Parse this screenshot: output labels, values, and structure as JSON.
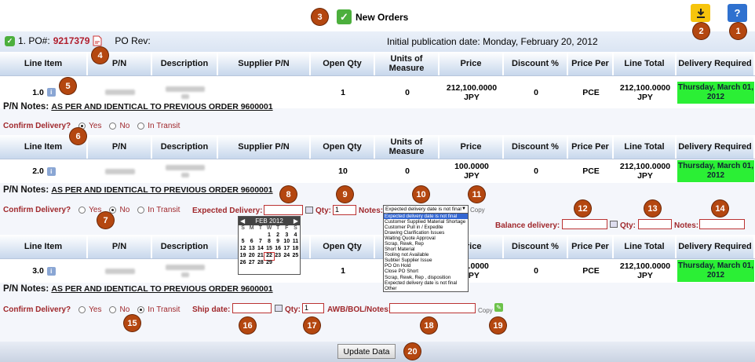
{
  "header": {
    "title": "New Orders",
    "po_label": "1. PO#:",
    "po_number": "9217379",
    "po_rev_label": "PO Rev:",
    "pub_date": "Initial publication date: Monday, February 20, 2012"
  },
  "columns": [
    "Line Item",
    "P/N",
    "Description",
    "Supplier P/N",
    "Open Qty",
    "Units of Measure",
    "Price",
    "Discount %",
    "Price Per",
    "Line Total",
    "Delivery Required"
  ],
  "rows": [
    {
      "line": "1.0",
      "open_qty": "1",
      "uom": "0",
      "price": "212,100.0000 JPY",
      "discount": "0",
      "price_per": "PCE",
      "total": "212,100.0000 JPY",
      "delivery": "Thursday, March 01, 2012",
      "pn_notes_label": "P/N Notes:",
      "pn_notes": "AS PER AND IDENTICAL TO PREVIOUS ORDER 9600001"
    },
    {
      "line": "2.0",
      "open_qty": "10",
      "uom": "0",
      "price": "100.0000 JPY",
      "discount": "0",
      "price_per": "PCE",
      "total": "212,100.0000 JPY",
      "delivery": "Thursday, March 01, 2012",
      "pn_notes_label": "P/N Notes:",
      "pn_notes": "AS PER AND IDENTICAL TO PREVIOUS ORDER 9600001"
    },
    {
      "line": "3.0",
      "open_qty": "1",
      "uom": "0",
      "price": "100.0000 JPY",
      "discount": "0",
      "price_per": "PCE",
      "total": "212,100.0000 JPY",
      "delivery": "Thursday, March 01, 2012",
      "pn_notes_label": "P/N Notes:",
      "pn_notes": "AS PER AND IDENTICAL TO PREVIOUS ORDER 9600001"
    }
  ],
  "confirm": {
    "label": "Confirm Delivery?",
    "yes": "Yes",
    "no": "No",
    "transit": "In Transit"
  },
  "row2_form": {
    "expected_label": "Expected Delivery:",
    "qty_label": "Qty:",
    "qty_value": "1",
    "notes_label": "Notes:",
    "copy_label": "Copy",
    "balance_label": "Balance delivery:",
    "balance_qty_label": "Qty:",
    "balance_notes_label": "Notes:"
  },
  "row3_form": {
    "ship_label": "Ship date:",
    "qty_label": "Qty:",
    "qty_value": "1",
    "awb_label": "AWB/BOL/Notes:",
    "copy_label": "Copy"
  },
  "calendar": {
    "month": "FEB 2012",
    "days_header": [
      "S",
      "M",
      "T",
      "W",
      "T",
      "F",
      "S"
    ],
    "days": [
      "",
      "",
      "",
      "1",
      "2",
      "3",
      "4",
      "5",
      "6",
      "7",
      "8",
      "9",
      "10",
      "11",
      "12",
      "13",
      "14",
      "15",
      "16",
      "17",
      "18",
      "19",
      "20",
      "21",
      "22",
      "23",
      "24",
      "25",
      "26",
      "27",
      "28",
      "29",
      "",
      "",
      ""
    ],
    "today": "22"
  },
  "dropdown": {
    "selected": "Expected delivery date is not final",
    "options": [
      "Expected delivery date is not final",
      "Customer Supplied Material Shortage",
      "Customer Pull in / Expedite",
      "Drawing Clarification Issues",
      "Waiting Quote Approval",
      "Scrap, Rewk, Rep",
      "Short Material",
      "Tooling not Available",
      "Subtier Supplier Issue",
      "PO On Hold",
      "Close PO Short",
      "Scrap, Rewk, Rep , disposition",
      "Expected delivery date is not final",
      "Other"
    ]
  },
  "update_button": "Update Data",
  "markers": [
    "1",
    "2",
    "3",
    "4",
    "5",
    "6",
    "7",
    "8",
    "9",
    "10",
    "11",
    "12",
    "13",
    "14",
    "15",
    "16",
    "17",
    "18",
    "19",
    "20"
  ],
  "colors": {
    "accent": "#b44710",
    "delivery": "#2bef35",
    "label_red": "#a0282c",
    "po_red": "#b01c2c"
  }
}
